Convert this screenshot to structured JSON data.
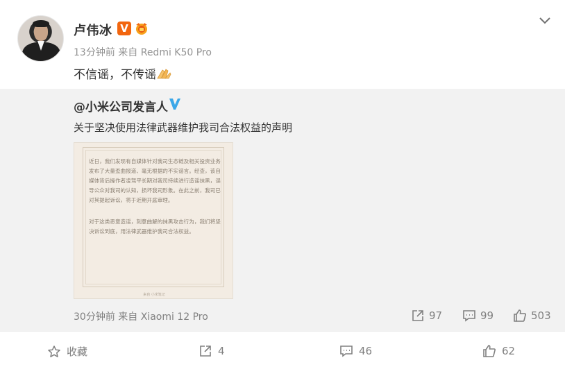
{
  "author": {
    "name": "卢伟冰",
    "vip_badge": "V",
    "meta": "13分钟前 来自 Redmi K50 Pro"
  },
  "post": {
    "text": "不信谣，不传谣"
  },
  "repost": {
    "author": "@小米公司发言人",
    "text": "关于坚决使用法律武器维护我司合法权益的声明",
    "image": {
      "paragraph1": "近日，我们发现有自媒体针对我司生态链及相关投资业务发布了大量歪曲报道、毫无根据的不实谣言。经查，该自媒体背后操作者凌驾平长期对我司持续进行造谣抹黑，误导公众对我司的认知，损坏我司形象。在此之前，我司已对其提起诉讼，将于近期开庭审理。",
      "paragraph2": "对于这类恶意造谣，刻意曲解的抹黑攻击行为，我们将坚决诉讼到底，用法律武器维护我司合法权益。",
      "footer": "来自 小米笔记"
    },
    "meta": "30分钟前 来自 Xiaomi 12 Pro",
    "shares": "97",
    "comments": "99",
    "likes": "503"
  },
  "actions": {
    "favorite_label": "收藏",
    "share_count": "4",
    "comment_count": "46",
    "like_count": "62"
  },
  "colors": {
    "vip_orange": "#f2660f",
    "verified_blue": "#1da1f2",
    "repost_bg": "#f2f2f2",
    "meta_gray": "#939393"
  }
}
